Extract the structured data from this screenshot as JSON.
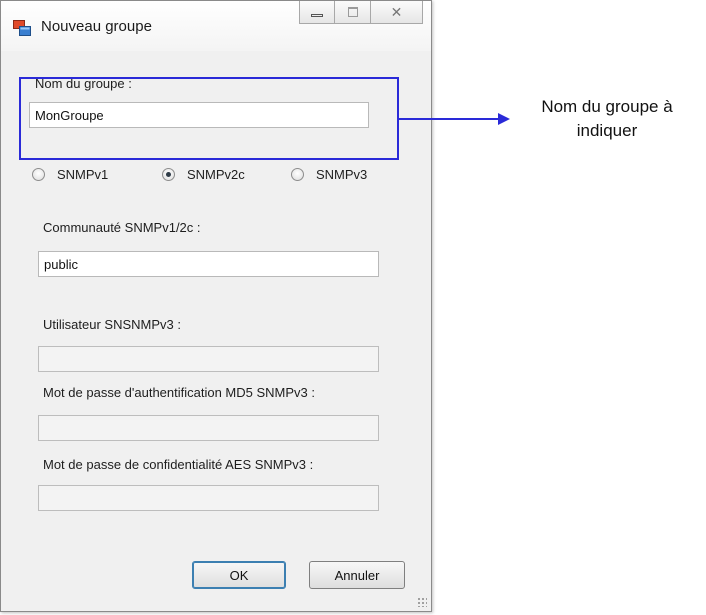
{
  "window": {
    "title": "Nouveau groupe",
    "buttons": [
      "minimize",
      "maximize",
      "close"
    ]
  },
  "group_name": {
    "label": "Nom du groupe :",
    "value": "MonGroupe"
  },
  "snmp_version": {
    "options": [
      "SNMPv1",
      "SNMPv2c",
      "SNMPv3"
    ],
    "selected": "SNMPv2c"
  },
  "community": {
    "label": "Communauté SNMPv1/2c  :",
    "value": "public"
  },
  "user": {
    "label": "Utilisateur SNSNMPv3 :",
    "value": ""
  },
  "auth_password": {
    "label": "Mot de passe d'authentification MD5 SNMPv3 :",
    "value": ""
  },
  "privacy_password": {
    "label": "Mot de passe de confidentialité AES SNMPv3 :",
    "value": ""
  },
  "actions": {
    "ok": "OK",
    "cancel": "Annuler"
  },
  "annotation": {
    "line1": "Nom du groupe à",
    "line2": "indiquer",
    "color": "#2a2ad8"
  },
  "icons": [
    "app-window-icon",
    "minimize-icon",
    "maximize-icon",
    "close-icon",
    "resize-grip-icon",
    "arrow-right-icon"
  ]
}
